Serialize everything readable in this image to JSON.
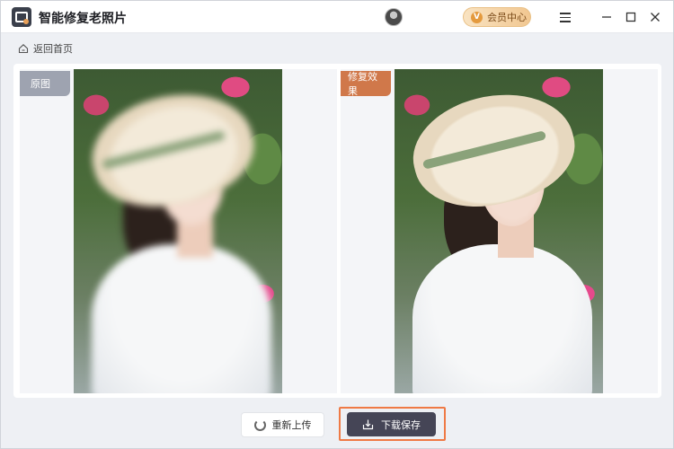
{
  "window": {
    "title": "智能修复老照片",
    "vip_label": "会员中心"
  },
  "nav": {
    "back_label": "返回首页"
  },
  "compare": {
    "original_label": "原图",
    "result_label": "修复效果"
  },
  "actions": {
    "reupload_label": "重新上传",
    "download_label": "下载保存"
  },
  "colors": {
    "accent_orange": "#ef7a45",
    "result_tag": "#d0784a",
    "original_tag": "#9ea3b0",
    "download_button": "#454556"
  },
  "icons": {
    "app": "photo-restore-app-icon",
    "vip": "diamond-v-icon",
    "menu": "hamburger-menu-icon",
    "back": "home-icon",
    "reupload": "refresh-icon",
    "download": "download-icon"
  }
}
